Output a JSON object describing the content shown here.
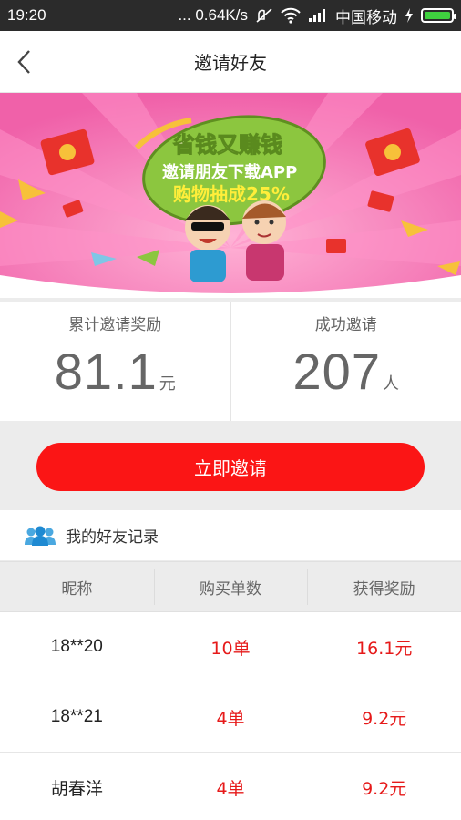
{
  "status_bar": {
    "time": "19:20",
    "net_speed": "... 0.64K/s",
    "carrier": "中国移动"
  },
  "header": {
    "title": "邀请好友"
  },
  "banner": {
    "headline": "省钱又赚钱",
    "line2": "邀请朋友下载APP",
    "line3": "购物抽成25%"
  },
  "stats": {
    "reward_label": "累计邀请奖励",
    "reward_value": "81.1",
    "reward_unit": "元",
    "success_label": "成功邀请",
    "success_value": "207",
    "success_unit": "人"
  },
  "invite_button": "立即邀请",
  "records": {
    "title": "我的好友记录",
    "columns": [
      "昵称",
      "购买单数",
      "获得奖励"
    ],
    "rows": [
      {
        "name": "18**20",
        "orders": "10单",
        "reward": "16.1元"
      },
      {
        "name": "18**21",
        "orders": "4单",
        "reward": "9.2元"
      },
      {
        "name": "胡春洋",
        "orders": "4单",
        "reward": "9.2元"
      }
    ]
  },
  "colors": {
    "accent_red": "#fb1515",
    "banner_pink": "#f56fb1",
    "banner_green": "#8cc63f"
  }
}
